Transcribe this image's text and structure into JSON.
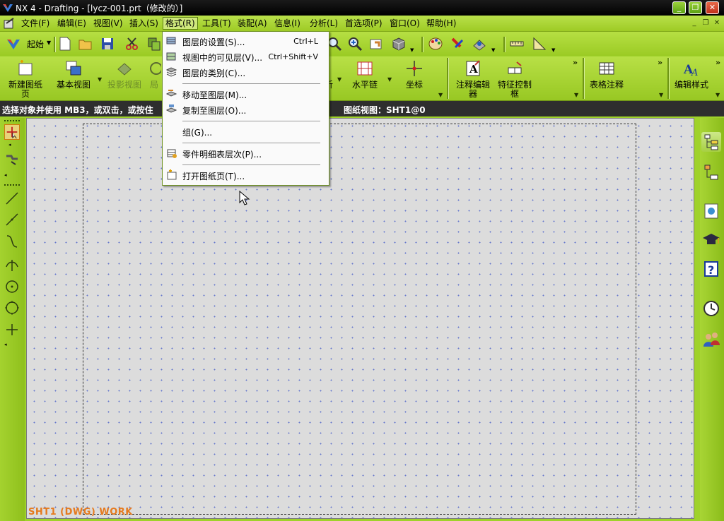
{
  "window": {
    "title": "NX 4 - Drafting - [lycz-001.prt（修改的）]"
  },
  "menubar": {
    "items": [
      {
        "label": "文件(F)",
        "active": false
      },
      {
        "label": "编辑(E)",
        "active": false
      },
      {
        "label": "视图(V)",
        "active": false
      },
      {
        "label": "插入(S)",
        "active": false
      },
      {
        "label": "格式(R)",
        "active": true
      },
      {
        "label": "工具(T)",
        "active": false
      },
      {
        "label": "装配(A)",
        "active": false
      },
      {
        "label": "信息(I)",
        "active": false
      },
      {
        "label": "分析(L)",
        "active": false
      },
      {
        "label": "首选项(P)",
        "active": false
      },
      {
        "label": "窗口(O)",
        "active": false
      },
      {
        "label": "帮助(H)",
        "active": false
      }
    ]
  },
  "std_toolbar": {
    "start_label": "起始"
  },
  "big_toolbar": {
    "buttons": [
      {
        "label": "新建图纸页"
      },
      {
        "label": "基本视图"
      },
      {
        "label": "投影视图"
      },
      {
        "label": "局"
      },
      {
        "label": "析"
      },
      {
        "label": "水平链"
      },
      {
        "label": "坐标"
      },
      {
        "label": "注释编辑器"
      },
      {
        "label": "特征控制框"
      },
      {
        "label": "表格注释"
      },
      {
        "label": "编辑样式"
      }
    ]
  },
  "statusbar": {
    "prompt": "选择对象并使用 MB3，或双击，或按住",
    "view": "图纸视图：SHT1@0"
  },
  "format_menu": {
    "items": [
      {
        "label": "图层的设置(S)...",
        "shortcut": "Ctrl+L",
        "icon": "layer-settings-icon"
      },
      {
        "label": "视图中的可见层(V)...",
        "shortcut": "Ctrl+Shift+V",
        "icon": "visible-layers-icon"
      },
      {
        "label": "图层的类别(C)...",
        "shortcut": "",
        "icon": "layer-category-icon"
      },
      {
        "label": "移动至图层(M)...",
        "shortcut": "",
        "icon": "move-to-layer-icon"
      },
      {
        "label": "复制至图层(O)...",
        "shortcut": "",
        "icon": "copy-to-layer-icon"
      },
      {
        "label": "组(G)...",
        "shortcut": "",
        "icon": ""
      },
      {
        "label": "零件明细表层次(P)...",
        "shortcut": "",
        "icon": "parts-list-levels-icon"
      },
      {
        "label": "打开图纸页(T)...",
        "shortcut": "",
        "icon": "open-drawing-sheet-icon"
      }
    ]
  },
  "canvas": {
    "sheet_label": "SHT1 (DWG) WORK"
  },
  "colors": {
    "accent_green": "#9fd22a",
    "sheet_label_orange": "#e57a1e",
    "status_bar_bg": "#2e2e2e"
  }
}
